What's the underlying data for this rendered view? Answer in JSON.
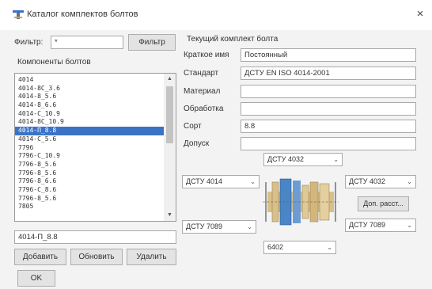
{
  "window": {
    "title": "Каталог комплектов болтов",
    "close_label": "×"
  },
  "filter": {
    "label": "Фильтр:",
    "value": "*",
    "button": "Фильтр"
  },
  "components": {
    "label": "Компоненты болтов",
    "items": [
      "4014",
      "4014-8С_3.6",
      "4014-8_5.6",
      "4014-8_6.6",
      "4014-С_10.9",
      "4014-8С_10.9",
      "4014-П_8.8",
      "4014-С_5.6",
      "7796",
      "7796-С_10.9",
      "7796-8_5.6",
      "7796-8_5.6",
      "7796-8_6.6",
      "7796-С_8.6",
      "7796-8_5.6",
      "7805"
    ],
    "selected_index": 6,
    "scroll_up": "▲",
    "scroll_down": "▼",
    "current_value": "4014-П_8.8"
  },
  "buttons": {
    "add": "Добавить",
    "refresh": "Обновить",
    "delete": "Удалить",
    "ok": "OK",
    "more": "Доп. расст..."
  },
  "bolt_set": {
    "group_title": "Текущий комплект болта",
    "fields": [
      {
        "label": "Краткое имя",
        "value": "Постоянный"
      },
      {
        "label": "Стандарт",
        "value": "ДСТУ EN ISO 4014-2001"
      },
      {
        "label": "Материал",
        "value": ""
      },
      {
        "label": "Обработка",
        "value": ""
      },
      {
        "label": "Сорт",
        "value": "8.8"
      },
      {
        "label": "Допуск",
        "value": ""
      }
    ]
  },
  "combos": {
    "top": "ДСТУ 4032",
    "left_upper": "ДСТУ 4014",
    "right_upper": "ДСТУ 4032",
    "left_lower": "ДСТУ 7089",
    "right_lower": "ДСТУ 7089",
    "bottom": "6402",
    "arrow": "⌄"
  },
  "colors": {
    "selection": "#3a73c6",
    "bolt_blue": "#4a86c5",
    "bolt_tan": "#d9c08a"
  }
}
